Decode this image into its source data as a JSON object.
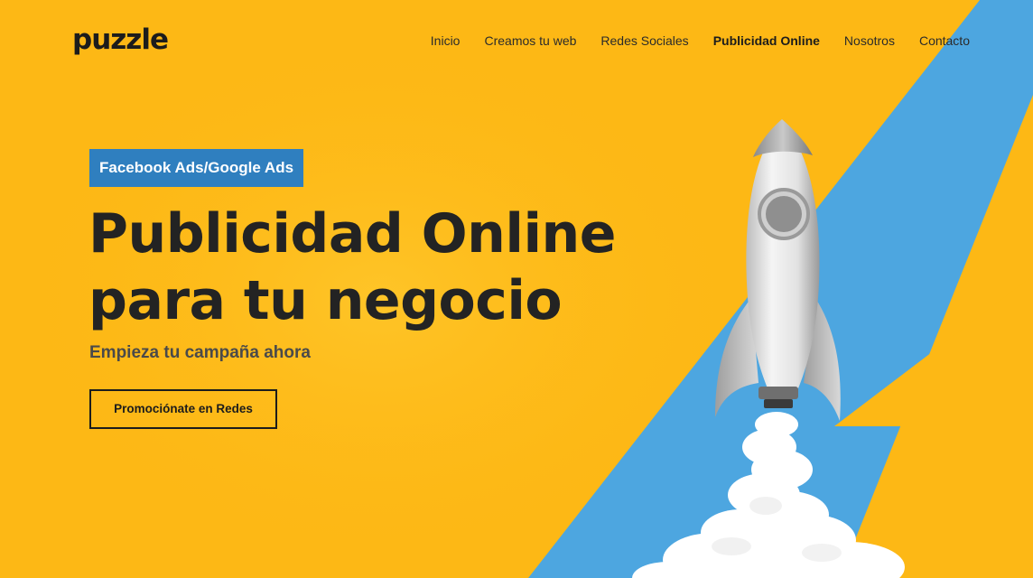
{
  "header": {
    "logo": "puzzle",
    "nav": [
      {
        "label": "Inicio",
        "active": false
      },
      {
        "label": "Creamos tu web",
        "active": false
      },
      {
        "label": "Redes Sociales",
        "active": false
      },
      {
        "label": "Publicidad Online",
        "active": true
      },
      {
        "label": "Nosotros",
        "active": false
      },
      {
        "label": "Contacto",
        "active": false
      }
    ]
  },
  "hero": {
    "badge": "Facebook Ads/Google Ads",
    "headline_line1": "Publicidad Online",
    "headline_line2": "para tu negocio",
    "subheadline": "Empieza tu campaña ahora",
    "cta_label": "Promociónate en Redes",
    "illustration": "rocket-launch-icon"
  },
  "colors": {
    "background": "#FDB815",
    "accent_blue": "#4DA6E0",
    "badge_blue": "#2F7FBF",
    "text_dark": "#232323"
  }
}
